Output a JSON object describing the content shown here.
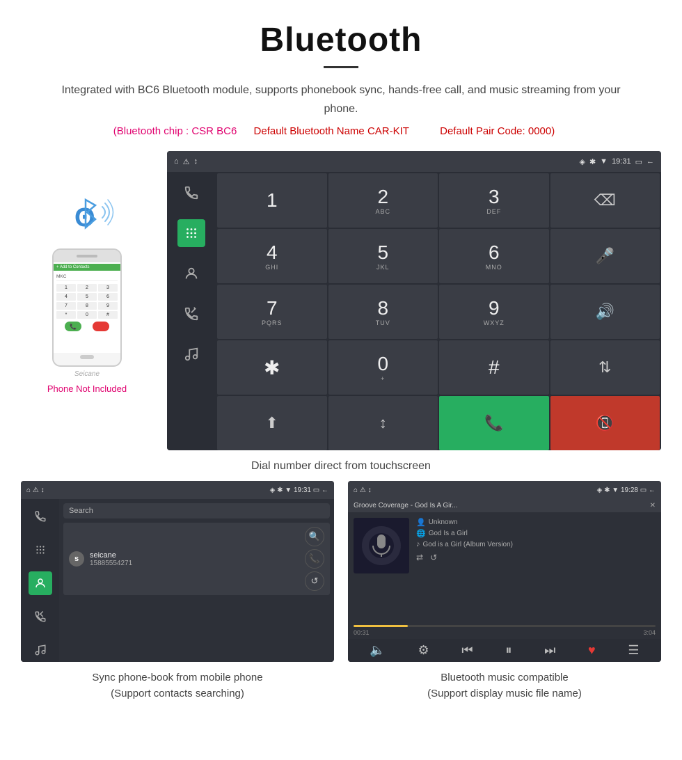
{
  "header": {
    "title": "Bluetooth",
    "description": "Integrated with BC6 Bluetooth module, supports phonebook sync, hands-free call, and music streaming from your phone.",
    "spec1": "(Bluetooth chip : CSR BC6",
    "spec2": "Default Bluetooth Name CAR-KIT",
    "spec3": "Default Pair Code: 0000)",
    "divider_label": "divider"
  },
  "car_screen": {
    "status_bar": {
      "left_icons": "⌂  ⚠  ↕",
      "time": "19:31",
      "right_icons": "📍 ✱ ▼"
    },
    "dialpad": {
      "keys": [
        {
          "main": "1",
          "sub": ""
        },
        {
          "main": "2",
          "sub": "ABC"
        },
        {
          "main": "3",
          "sub": "DEF"
        },
        {
          "main": "⌫",
          "sub": "",
          "type": "icon"
        },
        {
          "main": "4",
          "sub": "GHI"
        },
        {
          "main": "5",
          "sub": "JKL"
        },
        {
          "main": "6",
          "sub": "MNO"
        },
        {
          "main": "🎤",
          "sub": "",
          "type": "icon"
        },
        {
          "main": "7",
          "sub": "PQRS"
        },
        {
          "main": "8",
          "sub": "TUV"
        },
        {
          "main": "9",
          "sub": "WXYZ"
        },
        {
          "main": "🔊",
          "sub": "",
          "type": "icon"
        },
        {
          "main": "✱",
          "sub": ""
        },
        {
          "main": "0",
          "sub": "+"
        },
        {
          "main": "#",
          "sub": ""
        },
        {
          "main": "⇅",
          "sub": "",
          "type": "icon"
        },
        {
          "main": "⬆",
          "sub": "",
          "type": "icon"
        },
        {
          "main": "↕",
          "sub": "",
          "type": "icon"
        },
        {
          "main": "📞",
          "sub": "",
          "type": "green"
        },
        {
          "main": "📵",
          "sub": "",
          "type": "red"
        }
      ]
    }
  },
  "phone": {
    "not_included": "Phone Not Included",
    "watermark": "Seicane"
  },
  "main_caption": "Dial number direct from touchscreen",
  "contacts_screen": {
    "status_bar_left": "⌂  ⚠  ↕",
    "status_bar_right": "📍✱▼  19:31  🔋  ←",
    "search_placeholder": "Search",
    "contact": {
      "initial": "s",
      "name": "seicane",
      "number": "15885554271"
    }
  },
  "contacts_caption_line1": "Sync phone-book from mobile phone",
  "contacts_caption_line2": "(Support contacts searching)",
  "music_screen": {
    "status_bar_left": "⌂  ⚠  ↕",
    "status_bar_right": "📍✱▼  19:28  🔋  ←",
    "close_btn": "✕",
    "track_title": "Groove Coverage - God Is A Gir...",
    "meta1": "Unknown",
    "meta2": "God Is a Girl",
    "meta3": "God is a Girl (Album Version)",
    "time_current": "00:31",
    "time_total": "3:04",
    "progress_pct": 18
  },
  "music_caption_line1": "Bluetooth music compatible",
  "music_caption_line2": "(Support display music file name)"
}
